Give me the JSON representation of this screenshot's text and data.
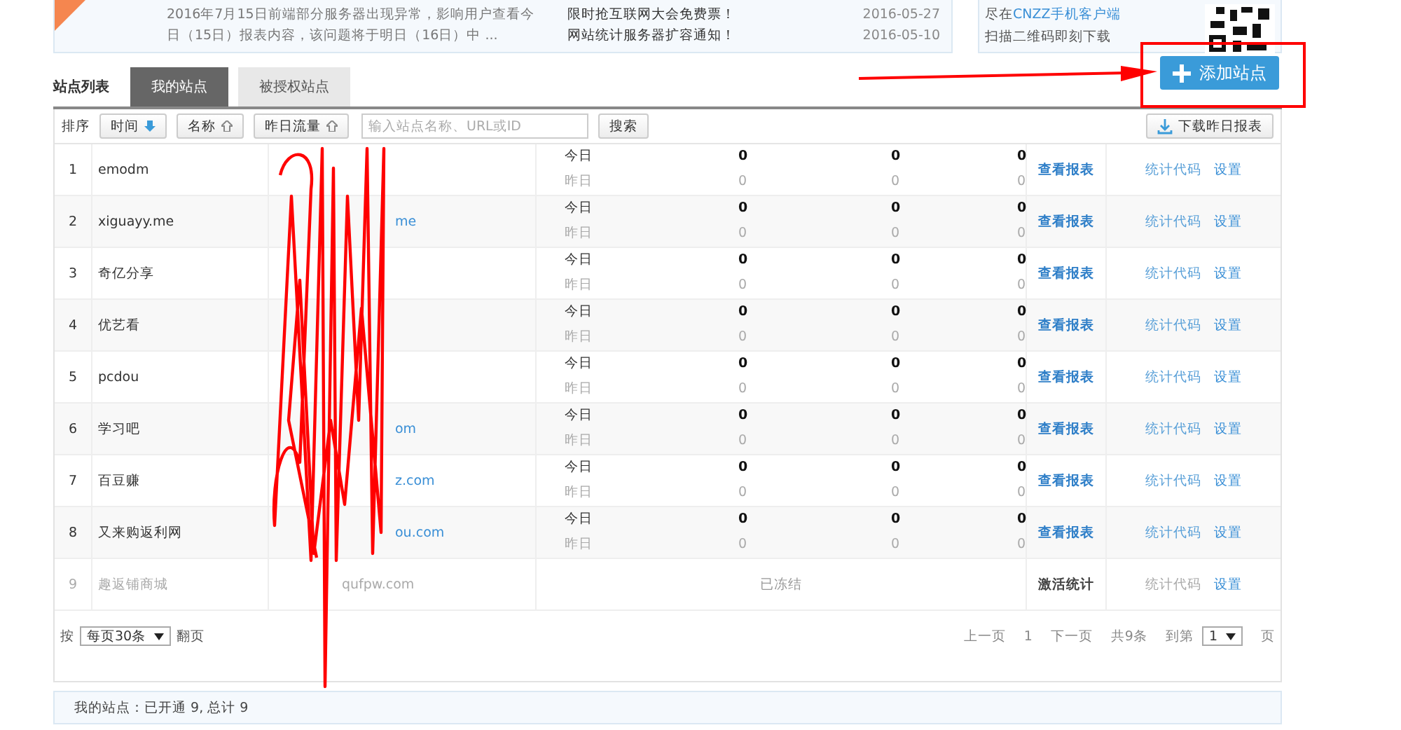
{
  "notice": {
    "text": "2016年7月15日前端部分服务器出现异常，影响用户查看今日（15日）报表内容，该问题将于明日（16日）中 ...",
    "news": [
      {
        "title": "限时抢互联网大会免费票！",
        "date": "2016-05-27"
      },
      {
        "title": "网站统计服务器扩容通知！",
        "date": "2016-05-10"
      }
    ]
  },
  "app_promo": {
    "prefix": "尽在",
    "link": "CNZZ手机客户端",
    "caption": "扫描二维码即刻下载"
  },
  "list_title": "站点列表",
  "tabs": [
    {
      "label": "我的站点",
      "selected": true
    },
    {
      "label": "被授权站点",
      "selected": false
    }
  ],
  "add_button": "添加站点",
  "toolbar": {
    "sort_label": "排序",
    "sorts": [
      {
        "label": "时间",
        "selected": true
      },
      {
        "label": "名称",
        "selected": false
      },
      {
        "label": "昨日流量",
        "selected": false
      }
    ],
    "search_placeholder": "输入站点名称、URL或ID",
    "search_button": "搜索",
    "download_button": "下载昨日报表"
  },
  "sites": [
    {
      "index": "1",
      "name": "emodm",
      "frozen": false,
      "today_label": "今日",
      "yesterday_label": "昨日",
      "today": [
        "0",
        "0",
        "0"
      ],
      "yesterday": [
        "0",
        "0",
        "0"
      ],
      "report": "查看报表",
      "code": "统计代码",
      "settings": "设置"
    },
    {
      "index": "2",
      "name": "xiguayy.me",
      "url": "me",
      "frozen": false,
      "today_label": "今日",
      "yesterday_label": "昨日",
      "today": [
        "0",
        "0",
        "0"
      ],
      "yesterday": [
        "0",
        "0",
        "0"
      ],
      "report": "查看报表",
      "code": "统计代码",
      "settings": "设置"
    },
    {
      "index": "3",
      "name": "奇亿分享",
      "frozen": false,
      "today_label": "今日",
      "yesterday_label": "昨日",
      "today": [
        "0",
        "0",
        "0"
      ],
      "yesterday": [
        "0",
        "0",
        "0"
      ],
      "report": "查看报表",
      "code": "统计代码",
      "settings": "设置"
    },
    {
      "index": "4",
      "name": "优艺看",
      "frozen": false,
      "today_label": "今日",
      "yesterday_label": "昨日",
      "today": [
        "0",
        "0",
        "0"
      ],
      "yesterday": [
        "0",
        "0",
        "0"
      ],
      "report": "查看报表",
      "code": "统计代码",
      "settings": "设置"
    },
    {
      "index": "5",
      "name": "pcdou",
      "frozen": false,
      "today_label": "今日",
      "yesterday_label": "昨日",
      "today": [
        "0",
        "0",
        "0"
      ],
      "yesterday": [
        "0",
        "0",
        "0"
      ],
      "report": "查看报表",
      "code": "统计代码",
      "settings": "设置"
    },
    {
      "index": "6",
      "name": "学习吧",
      "url": "om",
      "frozen": false,
      "today_label": "今日",
      "yesterday_label": "昨日",
      "today": [
        "0",
        "0",
        "0"
      ],
      "yesterday": [
        "0",
        "0",
        "0"
      ],
      "report": "查看报表",
      "code": "统计代码",
      "settings": "设置"
    },
    {
      "index": "7",
      "name": "百豆赚",
      "url": "z.com",
      "frozen": false,
      "today_label": "今日",
      "yesterday_label": "昨日",
      "today": [
        "0",
        "0",
        "0"
      ],
      "yesterday": [
        "0",
        "0",
        "0"
      ],
      "report": "查看报表",
      "code": "统计代码",
      "settings": "设置"
    },
    {
      "index": "8",
      "name": "又来购返利网",
      "url": "ou.com",
      "frozen": false,
      "today_label": "今日",
      "yesterday_label": "昨日",
      "today": [
        "0",
        "0",
        "0"
      ],
      "yesterday": [
        "0",
        "0",
        "0"
      ],
      "report": "查看报表",
      "code": "统计代码",
      "settings": "设置"
    },
    {
      "index": "9",
      "name": "趣返铺商城",
      "url": "qufpw.com",
      "frozen": true,
      "frozen_label": "已冻结",
      "activate": "激活统计",
      "code": "统计代码",
      "settings": "设置"
    }
  ],
  "pager": {
    "prefix": "按",
    "page_size": "每页30条",
    "suffix": "翻页",
    "prev": "上一页",
    "current": "1",
    "next": "下一页",
    "total": "共9条",
    "goto": "到第",
    "goto_value": "1",
    "page_unit": "页"
  },
  "summary": "我的站点：已开通 9, 总计 9"
}
